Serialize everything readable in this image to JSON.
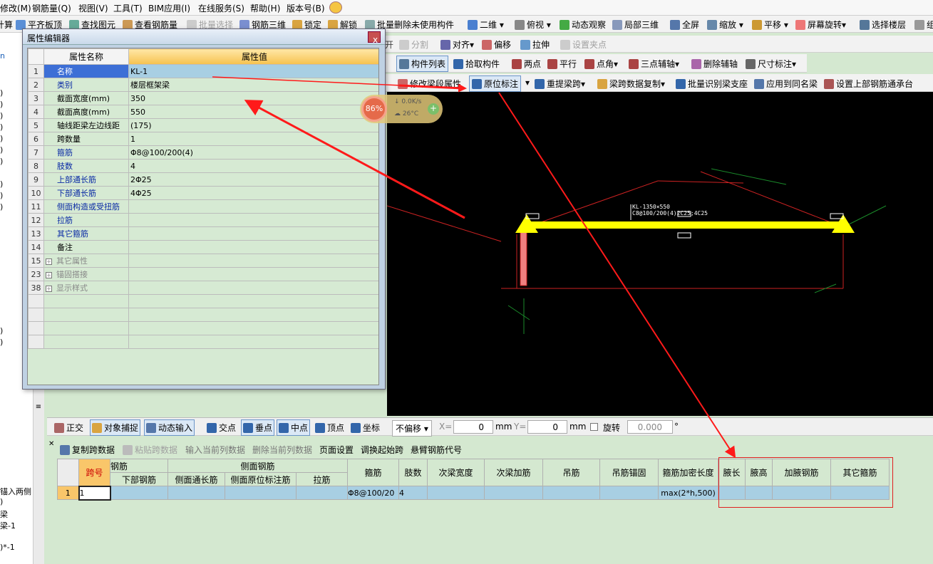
{
  "menubar": {
    "items": [
      "修改(M)",
      "钢筋量(Q)",
      "视图(V)",
      "工具(T)",
      "BIM应用(I)",
      "在线服务(S)",
      "帮助(H)",
      "版本号(B)"
    ]
  },
  "toolbar1": {
    "items": [
      "汇总计算",
      "平齐板顶",
      "查找图元",
      "查看钢筋量",
      "批量选择",
      "钢筋三维",
      "锁定",
      "解锁",
      "批量删除未使用构件",
      "二维",
      "俯视",
      "动态观察",
      "局部三维",
      "全屏",
      "缩放",
      "平移",
      "屏幕旋转",
      "选择楼层",
      "组"
    ]
  },
  "toolbar2": {
    "items": [
      "分割",
      "对齐",
      "偏移",
      "拉伸",
      "设置夹点"
    ]
  },
  "toolbar3": {
    "items": [
      "构件列表",
      "拾取构件",
      "两点",
      "平行",
      "点角",
      "三点辅轴",
      "删除辅轴",
      "尺寸标注"
    ]
  },
  "toolbar4": {
    "items": [
      "修改梁段属性",
      "原位标注",
      "重提梁跨",
      "梁跨数据复制",
      "批量识别梁支座",
      "应用到同名梁",
      "设置上部钢筋通承台"
    ]
  },
  "dialog": {
    "title": "属性编辑器",
    "close": "x",
    "col_name": "属性名称",
    "col_value": "属性值",
    "rows": [
      {
        "n": "1",
        "name": "名称",
        "value": "KL-1",
        "blue": true
      },
      {
        "n": "2",
        "name": "类别",
        "value": "楼层框架梁",
        "blue": true
      },
      {
        "n": "3",
        "name": "截面宽度(mm)",
        "value": "350",
        "blue": false
      },
      {
        "n": "4",
        "name": "截面高度(mm)",
        "value": "550",
        "blue": false
      },
      {
        "n": "5",
        "name": "轴线距梁左边线距",
        "value": "(175)",
        "blue": false
      },
      {
        "n": "6",
        "name": "跨数量",
        "value": "1",
        "blue": false
      },
      {
        "n": "7",
        "name": "箍筋",
        "value": "Φ8@100/200(4)",
        "blue": true
      },
      {
        "n": "8",
        "name": "肢数",
        "value": "4",
        "blue": true
      },
      {
        "n": "9",
        "name": "上部通长筋",
        "value": "2Φ25",
        "blue": true
      },
      {
        "n": "10",
        "name": "下部通长筋",
        "value": "4Φ25",
        "blue": true
      },
      {
        "n": "11",
        "name": "侧面构造或受扭筋",
        "value": "",
        "blue": true
      },
      {
        "n": "12",
        "name": "拉筋",
        "value": "",
        "blue": true
      },
      {
        "n": "13",
        "name": "其它箍筋",
        "value": "",
        "blue": true
      },
      {
        "n": "14",
        "name": "备注",
        "value": "",
        "blue": false
      },
      {
        "n": "15",
        "name": "其它属性",
        "value": "",
        "blue": false,
        "group": true
      },
      {
        "n": "23",
        "name": "锚固搭接",
        "value": "",
        "blue": false,
        "group": true
      },
      {
        "n": "38",
        "name": "显示样式",
        "value": "",
        "blue": false,
        "group": true
      }
    ]
  },
  "widget": {
    "percent": "86%",
    "speed": "0.0K/s",
    "temp": "26°C",
    "plus": "+"
  },
  "cad": {
    "label1": "KL-1350×550",
    "label2": "C8@100/200(4)2C25;4C25"
  },
  "snapbar": {
    "items": [
      "正交",
      "对象捕捉",
      "动态输入",
      "交点",
      "垂点",
      "中点",
      "顶点",
      "坐标"
    ],
    "offset": "不偏移",
    "x_label": "X=",
    "x_val": "0",
    "y_label": "Y=",
    "y_val": "0",
    "unit": "mm",
    "rot_label": "旋转",
    "rot_val": "0.000",
    "deg": "°"
  },
  "spanbar": {
    "items": [
      "复制跨数据",
      "粘贴跨数据",
      "输入当前列数据",
      "删除当前列数据",
      "页面设置",
      "调换起始跨",
      "悬臂钢筋代号"
    ]
  },
  "span_table": {
    "h_span": "跨号",
    "h_rebar": "钢筋",
    "h_side": "侧面钢筋",
    "h_bottom": "下部钢筋",
    "h_side_long": "侧面通长筋",
    "h_side_orig": "侧面原位标注筋",
    "h_tie": "拉筋",
    "h_stirrup": "箍筋",
    "h_legs": "肢数",
    "h_sec_w": "次梁宽度",
    "h_sec_add": "次梁加筋",
    "h_hanger": "吊筋",
    "h_hanger_anchor": "吊筋锚固",
    "h_dense": "箍筋加密长度",
    "h_haunch_l": "腋长",
    "h_haunch_h": "腋高",
    "h_haunch_bar": "加腋钢筋",
    "h_other": "其它箍筋",
    "row": {
      "n": "1",
      "span": "1",
      "stirrup": "Φ8@100/20",
      "legs": "4",
      "dense": "max(2*h,500)"
    }
  },
  "left_panel": {
    "items": [
      ")",
      ")",
      ")",
      ")",
      ")",
      ")",
      ")",
      ")",
      ")",
      ")",
      ")",
      ")",
      ")",
      ")",
      ")"
    ],
    "texts": [
      "锚入两侧",
      "梁",
      "梁-1",
      ")*-1"
    ]
  },
  "colors": {
    "arrow": "#ff1a1a",
    "beam": "#ffff00",
    "bg": "#d4e8d0",
    "grid": "#d6ead3"
  }
}
